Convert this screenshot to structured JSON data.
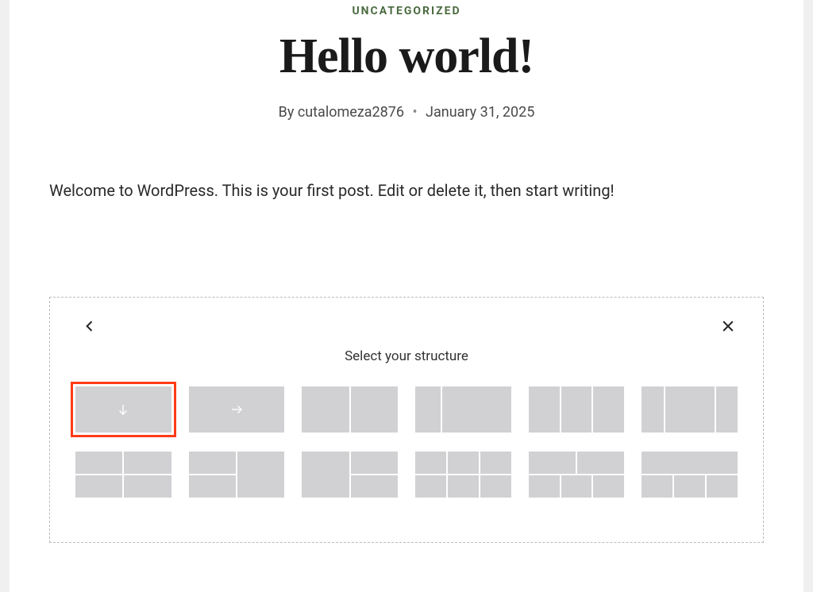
{
  "post": {
    "category": "UNCATEGORIZED",
    "title": "Hello world!",
    "by_label": "By",
    "author": "cutalomeza2876",
    "date": "January 31, 2025",
    "content": "Welcome to WordPress. This is your first post. Edit or delete it, then start writing!"
  },
  "picker": {
    "title": "Select your structure",
    "selected_index": 0,
    "options": [
      "single-column",
      "single-column-arrow-right",
      "two-columns",
      "two-columns-narrow-left",
      "three-columns",
      "three-columns-wide-middle",
      "two-rows-two-cols",
      "left-split-right-full",
      "left-full-right-split",
      "two-rows-three-cols",
      "two-rows-top-two-bottom-three",
      "top-full-bottom-three"
    ]
  }
}
